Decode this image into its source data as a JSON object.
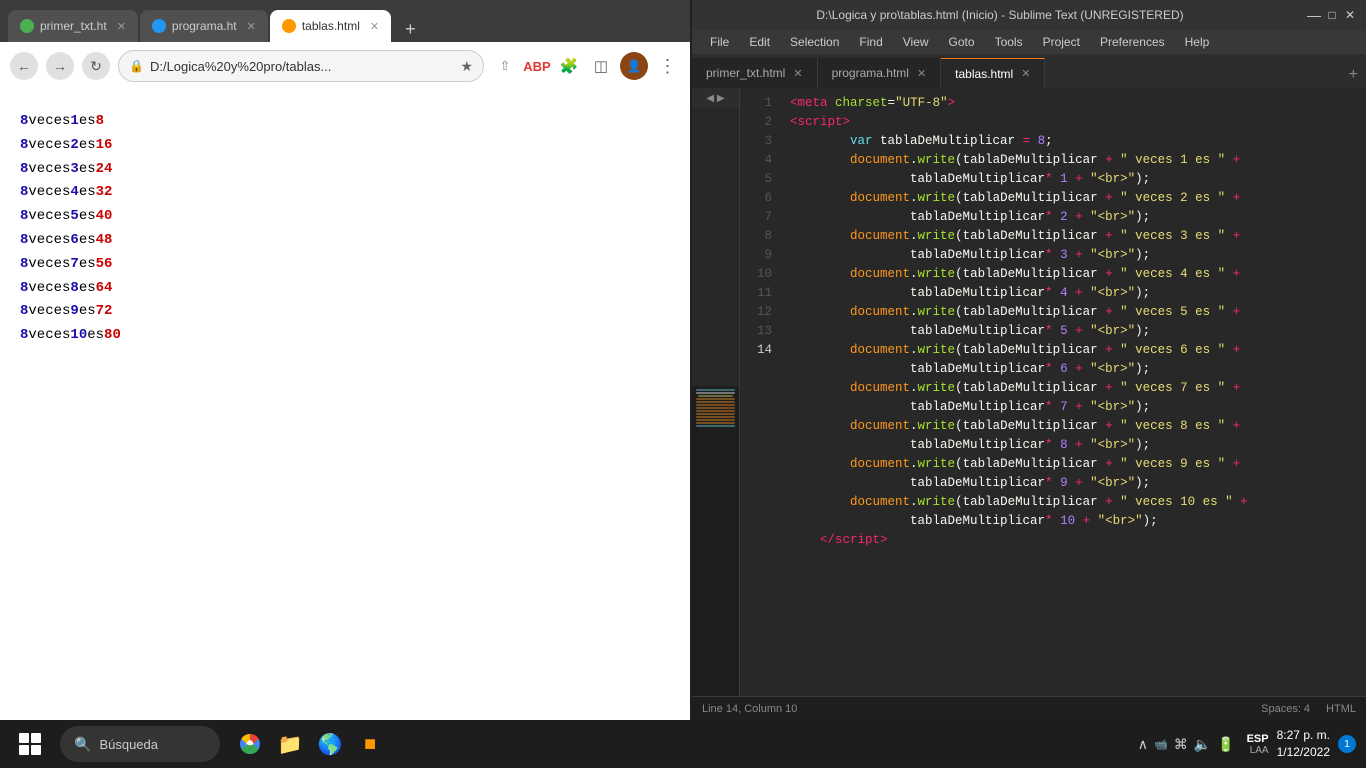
{
  "browser": {
    "tabs": [
      {
        "id": "tab1",
        "label": "primer_txt.ht",
        "favicon": "green",
        "active": false
      },
      {
        "id": "tab2",
        "label": "programa.ht",
        "favicon": "blue",
        "active": false
      },
      {
        "id": "tab3",
        "label": "tablas.html",
        "favicon": "orange",
        "active": true
      }
    ],
    "address": "D:/Logica%20y%20pro/tablas...",
    "content": {
      "lines": [
        {
          "prefix": "8 veces ",
          "n1": "1",
          "middle": " es ",
          "n2": "8"
        },
        {
          "prefix": "8 veces ",
          "n1": "2",
          "middle": " es ",
          "n2": "16"
        },
        {
          "prefix": "8 veces ",
          "n1": "3",
          "middle": " es ",
          "n2": "24"
        },
        {
          "prefix": "8 veces ",
          "n1": "4",
          "middle": " es ",
          "n2": "32"
        },
        {
          "prefix": "8 veces ",
          "n1": "5",
          "middle": " es ",
          "n2": "40"
        },
        {
          "prefix": "8 veces ",
          "n1": "6",
          "middle": " es ",
          "n2": "48"
        },
        {
          "prefix": "8 veces ",
          "n1": "7",
          "middle": " es ",
          "n2": "56"
        },
        {
          "prefix": "8 veces ",
          "n1": "8",
          "middle": " es ",
          "n2": "64"
        },
        {
          "prefix": "8 veces ",
          "n1": "9",
          "middle": " es ",
          "n2": "72"
        },
        {
          "prefix": "8 veces ",
          "n1": "10",
          "middle": " es ",
          "n2": "80"
        }
      ]
    }
  },
  "editor": {
    "titlebar": "D:\\Logica y pro\\tablas.html (Inicio) - Sublime Text (UNREGISTERED)",
    "menu": [
      "File",
      "Edit",
      "Selection",
      "Find",
      "View",
      "Goto",
      "Tools",
      "Project",
      "Preferences",
      "Help"
    ],
    "tabs": [
      {
        "id": "t1",
        "label": "primer_txt.html",
        "active": false
      },
      {
        "id": "t2",
        "label": "programa.html",
        "active": false
      },
      {
        "id": "t3",
        "label": "tablas.html",
        "active": true
      }
    ],
    "fold_header": "FOLD",
    "statusbar": {
      "position": "Line 14, Column 10",
      "spaces": "Spaces: 4",
      "syntax": "HTML"
    }
  },
  "taskbar": {
    "search_placeholder": "Búsqueda",
    "language": "ESP",
    "region": "LAA",
    "time": "8:27 p. m.",
    "date": "1/12/2022",
    "notification_count": "1"
  }
}
